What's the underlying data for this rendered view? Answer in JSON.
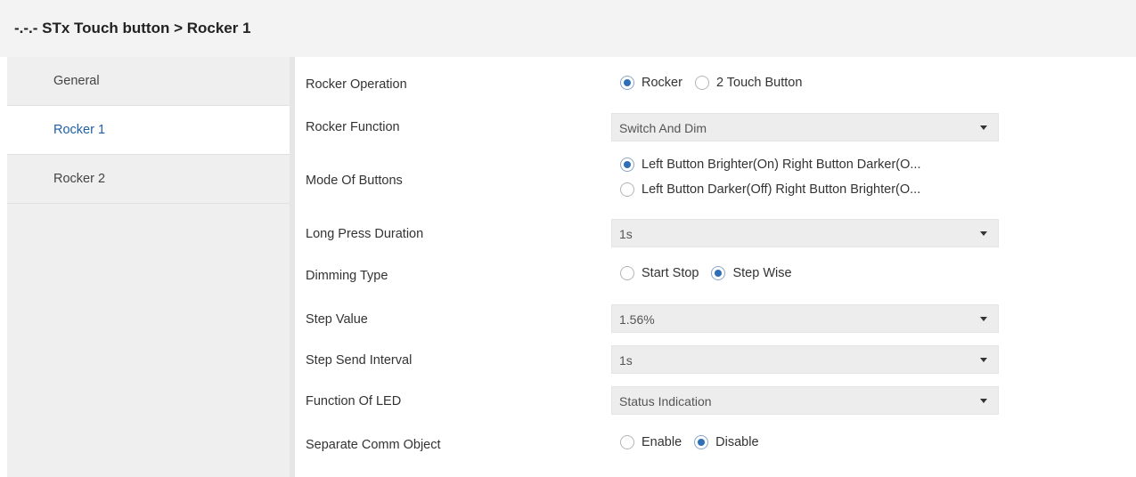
{
  "header": {
    "title": "-.-.- STx Touch button > Rocker 1"
  },
  "sidebar": {
    "items": [
      {
        "label": "General"
      },
      {
        "label": "Rocker 1"
      },
      {
        "label": "Rocker 2"
      }
    ],
    "active": "Rocker 1"
  },
  "settings": {
    "rocker_operation": {
      "label": "Rocker Operation",
      "options": [
        "Rocker",
        "2 Touch Button"
      ],
      "selected": "Rocker"
    },
    "rocker_function": {
      "label": "Rocker Function",
      "value": "Switch And Dim"
    },
    "mode_of_buttons": {
      "label": "Mode Of Buttons",
      "options": [
        "Left Button Brighter(On) Right Button Darker(O...",
        "Left Button Darker(Off) Right Button Brighter(O..."
      ],
      "selected": "Left Button Brighter(On) Right Button Darker(O..."
    },
    "long_press_duration": {
      "label": "Long Press Duration",
      "value": "1s"
    },
    "dimming_type": {
      "label": "Dimming Type",
      "options": [
        "Start Stop",
        "Step Wise"
      ],
      "selected": "Step Wise"
    },
    "step_value": {
      "label": "Step Value",
      "value": "1.56%"
    },
    "step_send_interval": {
      "label": "Step Send Interval",
      "value": "1s"
    },
    "function_of_led": {
      "label": "Function Of LED",
      "value": "Status Indication"
    },
    "separate_comm_object": {
      "label": "Separate Comm Object",
      "options": [
        "Enable",
        "Disable"
      ],
      "selected": "Disable"
    }
  },
  "colors": {
    "accent": "#2e6fb8",
    "active_nav_text": "#1f5fa8",
    "sidebar_bg": "#efefef",
    "select_bg": "#ededed"
  },
  "icons": {
    "dropdown": "chevron-down-icon",
    "radio_checked": "radio-checked-icon",
    "radio_unchecked": "radio-unchecked-icon"
  }
}
